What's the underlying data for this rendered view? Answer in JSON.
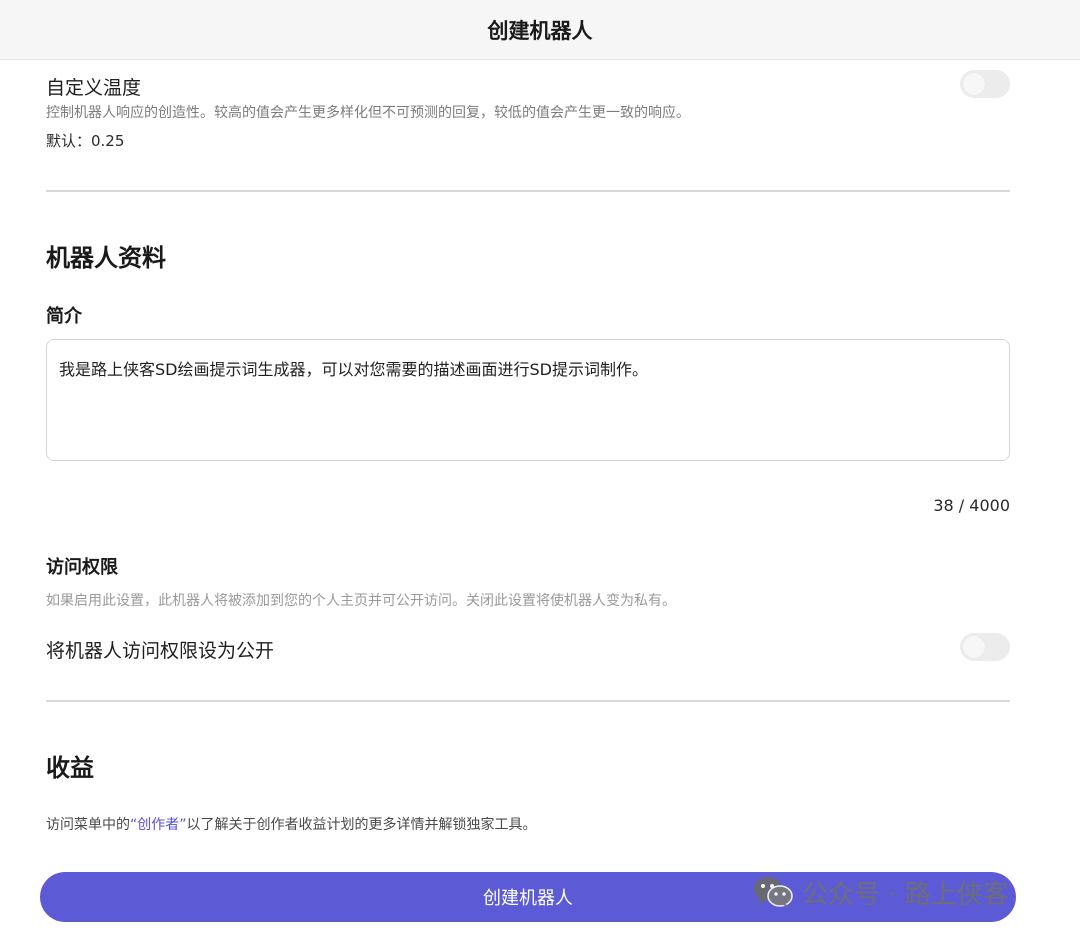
{
  "header": {
    "title": "创建机器人"
  },
  "temperature": {
    "label": "自定义温度",
    "description": "控制机器人响应的创造性。较高的值会产生更多样化但不可预测的回复，较低的值会产生更一致的响应。",
    "default_text": "默认：0.25",
    "toggle_on": false
  },
  "profile": {
    "section_title": "机器人资料",
    "intro_label": "简介",
    "intro_value": "我是路上侠客SD绘画提示词生成器，可以对您需要的描述画面进行SD提示词制作。",
    "char_count": "38 / 4000"
  },
  "access": {
    "title": "访问权限",
    "description": "如果启用此设置，此机器人将被添加到您的个人主页并可公开访问。关闭此设置将使机器人变为私有。",
    "toggle_label": "将机器人访问权限设为公开",
    "toggle_on": false
  },
  "revenue": {
    "section_title": "收益",
    "text_prefix": "访问菜单中的",
    "link_text": "“创作者”",
    "text_suffix": "以了解关于创作者收益计划的更多详情并解锁独家工具。"
  },
  "footer": {
    "create_button": "创建机器人"
  },
  "watermark": {
    "text": "公众号 · 路上侠客",
    "icon": "wechat-icon"
  },
  "colors": {
    "accent": "#5d5ad6",
    "link": "#5a4fd6"
  }
}
